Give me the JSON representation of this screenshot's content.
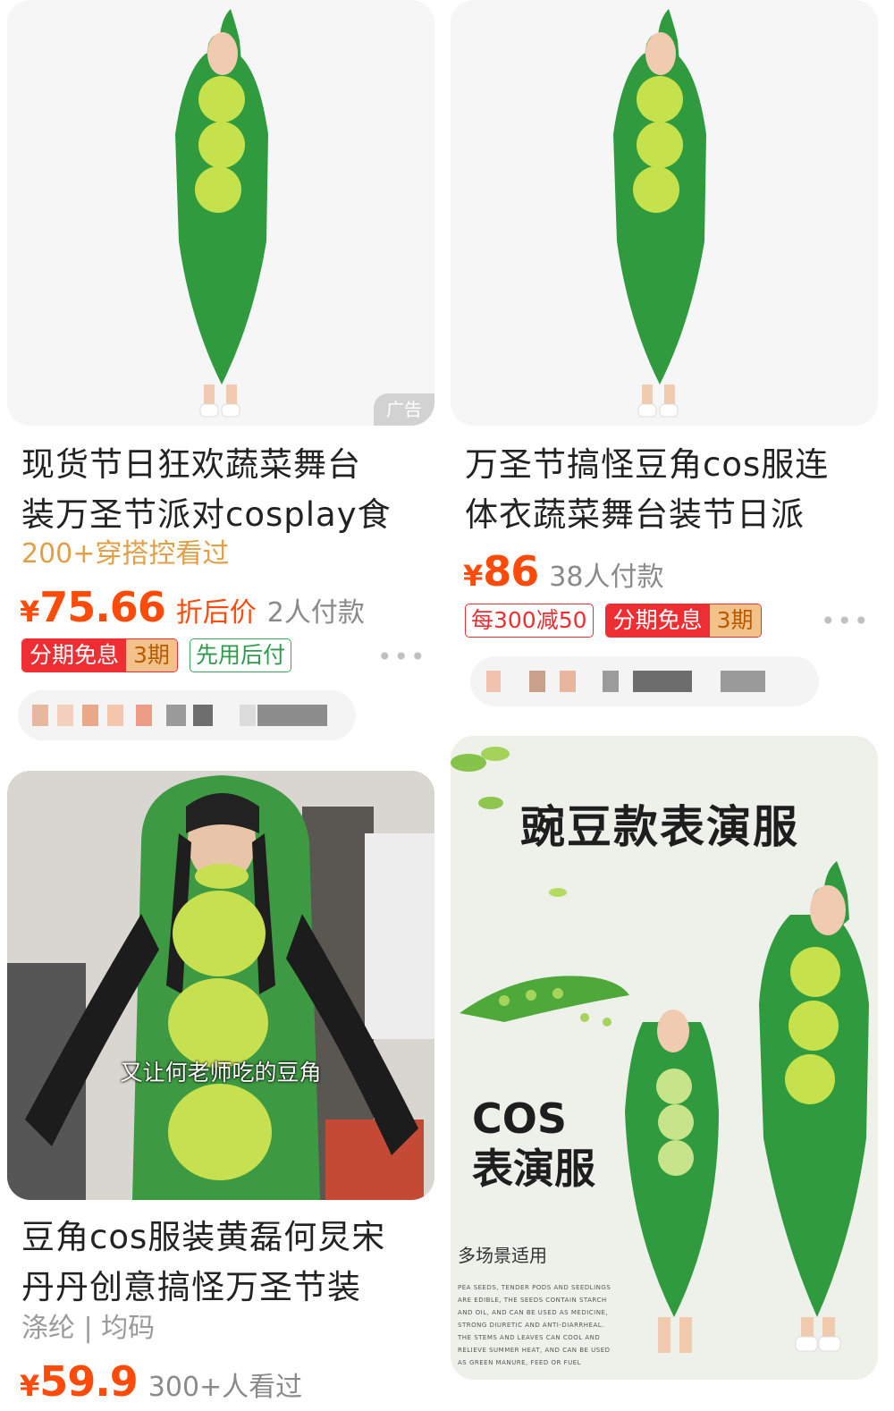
{
  "products": [
    {
      "ad_label": "广告",
      "title_line1": "现货节日狂欢蔬菜舞台",
      "title_line2": "装万圣节派对cosplay食",
      "views": "200+穿搭控看过",
      "currency": "¥",
      "price": "75.66",
      "price_note": "折后价",
      "paid_count": "2人付款",
      "tags": {
        "installment": "分期免息",
        "periods": "3期",
        "pay_later": "先用后付"
      },
      "more": "•••"
    },
    {
      "title_line1": "万圣节搞怪豆角cos服连",
      "title_line2": "体衣蔬菜舞台装节日派",
      "currency": "¥",
      "price": "86",
      "paid_count": "38人付款",
      "tags": {
        "discount": "每300减50",
        "installment": "分期免息",
        "periods": "3期"
      },
      "more": "•••"
    },
    {
      "video_caption": "又让何老师吃的豆角",
      "title_line1": "豆角cos服装黄磊何炅宋",
      "title_line2": "丹丹创意搞怪万圣节装",
      "attributes": "涤纶 | 均码",
      "currency": "¥",
      "price": "59.9",
      "views": "300+人看过"
    },
    {
      "poster_title": "豌豆款表演服",
      "poster_cos": "COS",
      "poster_subtitle": "表演服",
      "poster_scene": "多场景适用",
      "poster_small_text": "PEA SEEDS, TENDER PODS AND SEEDLINGS ARE EDIBLE, THE SEEDS CONTAIN STARCH AND OIL, AND CAN BE USED AS MEDICINE, STRONG DIURETIC AND ANTI-DIARRHEAL. THE STEMS AND LEAVES CAN COOL AND RELIEVE SUMMER HEAT, AND CAN BE USED AS GREEN MANURE, FEED OR FUEL"
    }
  ],
  "colors": {
    "accent": "#ff4b0a",
    "pea_green": "#2e9a3e",
    "pea_light": "#c2e04a"
  }
}
